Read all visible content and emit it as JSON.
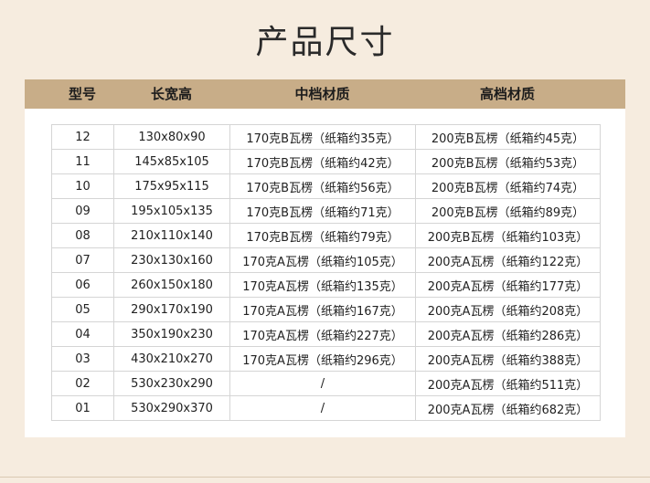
{
  "page": {
    "title": "产品尺寸"
  },
  "header": {
    "columns": [
      "型号",
      "长宽高",
      "中档材质",
      "高档材质"
    ]
  },
  "colors": {
    "background": "#f6ecdf",
    "header_bar": "#c8ad88",
    "card": "#ffffff",
    "border": "#d5d5d5"
  },
  "table": {
    "rows": [
      {
        "model": "12",
        "size": "130x80x90",
        "mid": "170克B瓦楞（纸箱约35克）",
        "high": "200克B瓦楞（纸箱约45克）"
      },
      {
        "model": "11",
        "size": "145x85x105",
        "mid": "170克B瓦楞（纸箱约42克）",
        "high": "200克B瓦楞（纸箱约53克）"
      },
      {
        "model": "10",
        "size": "175x95x115",
        "mid": "170克B瓦楞（纸箱约56克）",
        "high": "200克B瓦楞（纸箱约74克）"
      },
      {
        "model": "09",
        "size": "195x105x135",
        "mid": "170克B瓦楞（纸箱约71克）",
        "high": "200克B瓦楞（纸箱约89克）"
      },
      {
        "model": "08",
        "size": "210x110x140",
        "mid": "170克B瓦楞（纸箱约79克）",
        "high": "200克B瓦楞（纸箱约103克）"
      },
      {
        "model": "07",
        "size": "230x130x160",
        "mid": "170克A瓦楞（纸箱约105克）",
        "high": "200克A瓦楞（纸箱约122克）"
      },
      {
        "model": "06",
        "size": "260x150x180",
        "mid": "170克A瓦楞（纸箱约135克）",
        "high": "200克A瓦楞（纸箱约177克）"
      },
      {
        "model": "05",
        "size": "290x170x190",
        "mid": "170克A瓦楞（纸箱约167克）",
        "high": "200克A瓦楞（纸箱约208克）"
      },
      {
        "model": "04",
        "size": "350x190x230",
        "mid": "170克A瓦楞（纸箱约227克）",
        "high": "200克A瓦楞（纸箱约286克）"
      },
      {
        "model": "03",
        "size": "430x210x270",
        "mid": "170克A瓦楞（纸箱约296克）",
        "high": "200克A瓦楞（纸箱约388克）"
      },
      {
        "model": "02",
        "size": "530x230x290",
        "mid": "/",
        "high": "200克A瓦楞（纸箱约511克）"
      },
      {
        "model": "01",
        "size": "530x290x370",
        "mid": "/",
        "high": "200克A瓦楞（纸箱约682克）"
      }
    ]
  }
}
